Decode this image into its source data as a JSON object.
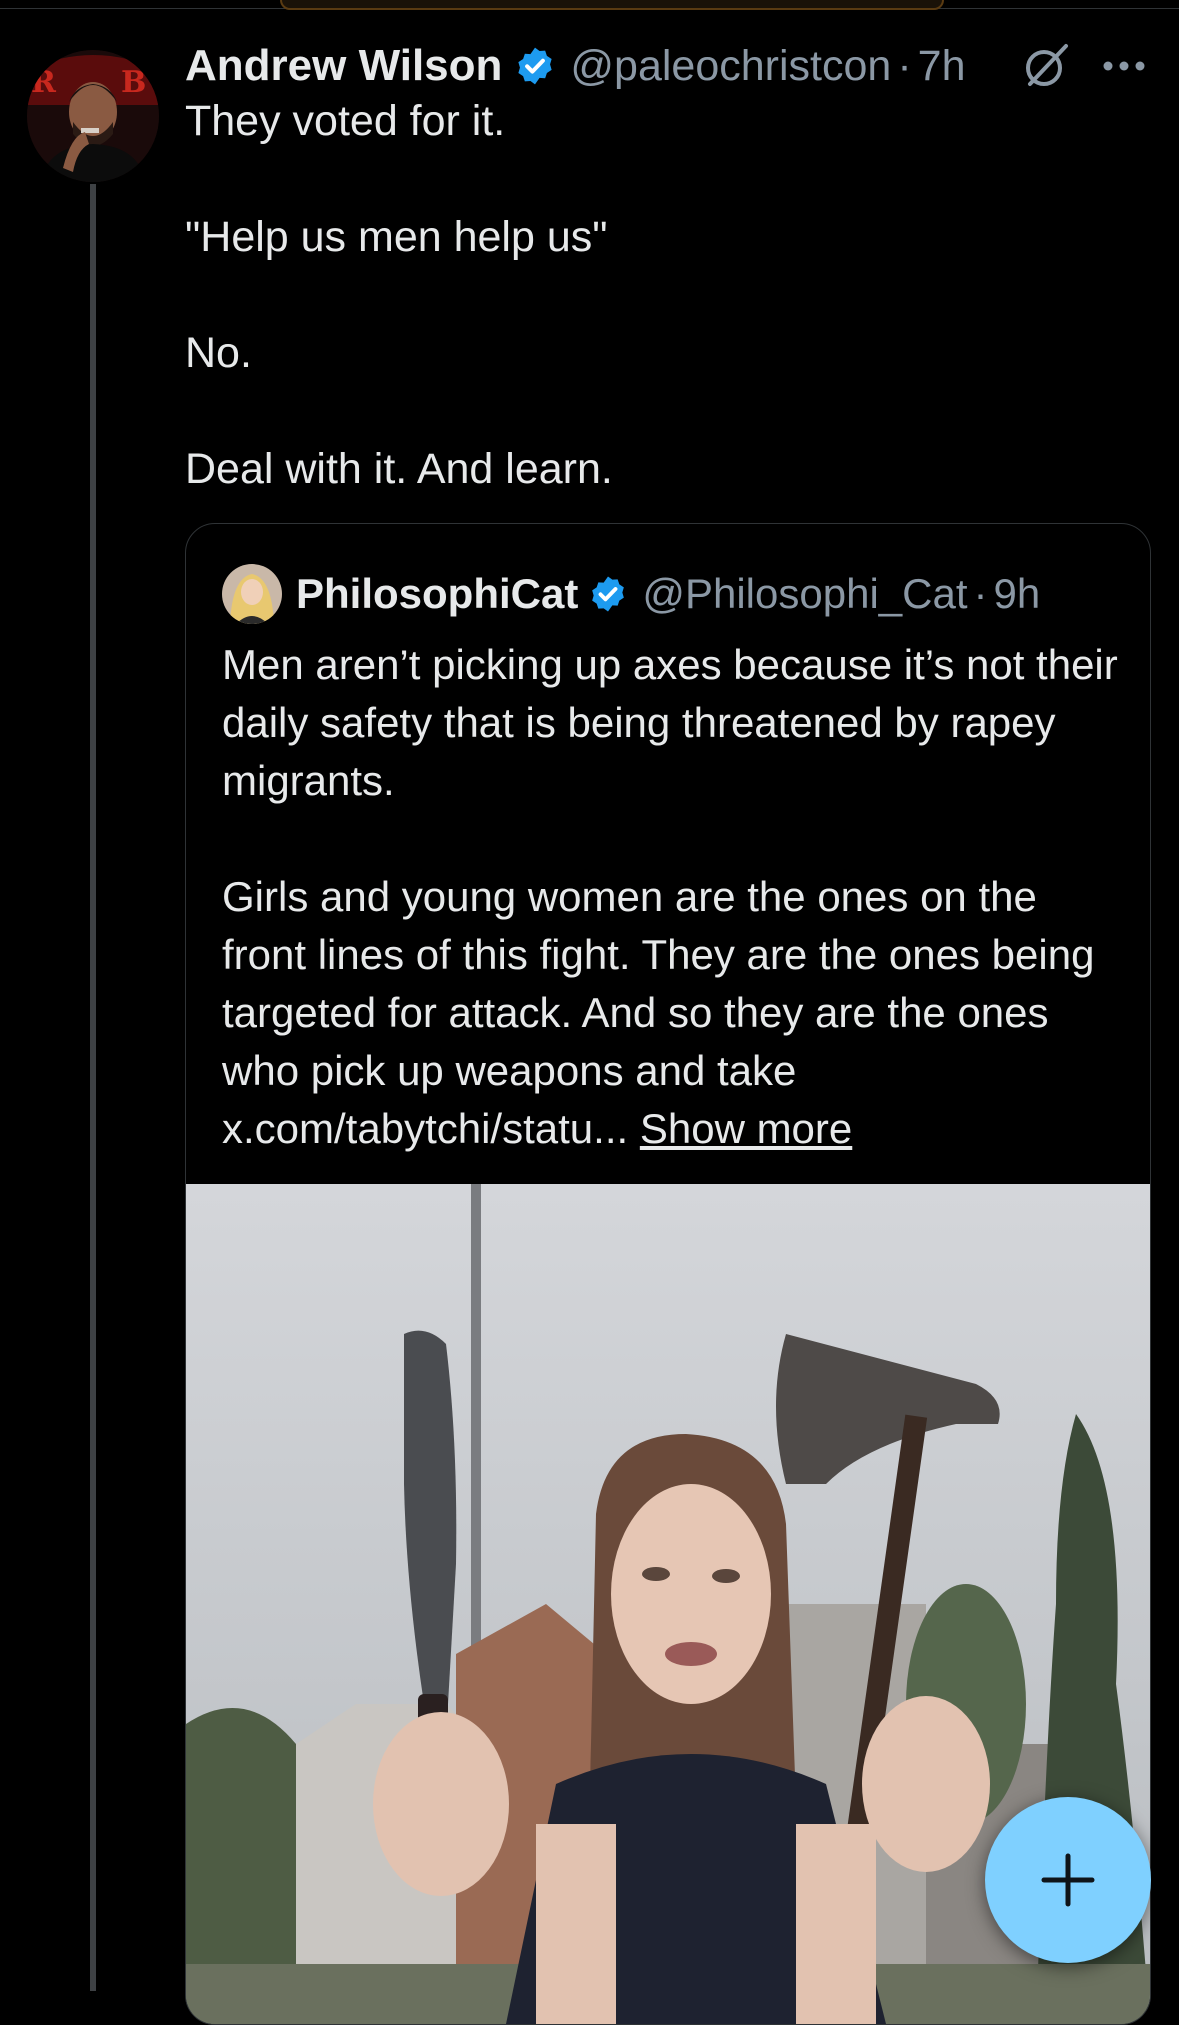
{
  "tweet": {
    "author_name": "Andrew Wilson",
    "handle": "@paleochristcon",
    "separator": "·",
    "time": "7h",
    "lines": [
      "They voted for it.",
      "",
      "\"Help us men help us\"",
      "",
      "No.",
      "",
      "Deal with it. And learn."
    ]
  },
  "quote": {
    "author_name": "PhilosophiCat",
    "handle": "@Philosophi_Cat",
    "separator": "·",
    "time": "9h",
    "para1": "Men aren’t picking up axes because it’s not their daily safety that is being threatened by rapey migrants.",
    "para2": "Girls and young women are the ones on the front lines of this fight. They are the ones being targeted for attack. And so they are the ones who pick up weapons and take x.com/tabytchi/statu...",
    "show_more": "Show more"
  },
  "colors": {
    "background": "#000000",
    "text": "#e7e9ea",
    "secondary_text": "#8b98a5",
    "verified_blue": "#1d9bf0",
    "fab": "#7fd0ff",
    "border": "#2f3336"
  },
  "icons": {
    "verified": "verified-badge-icon",
    "grok": "grok-icon",
    "more": "more-options-icon",
    "compose": "plus-icon"
  }
}
